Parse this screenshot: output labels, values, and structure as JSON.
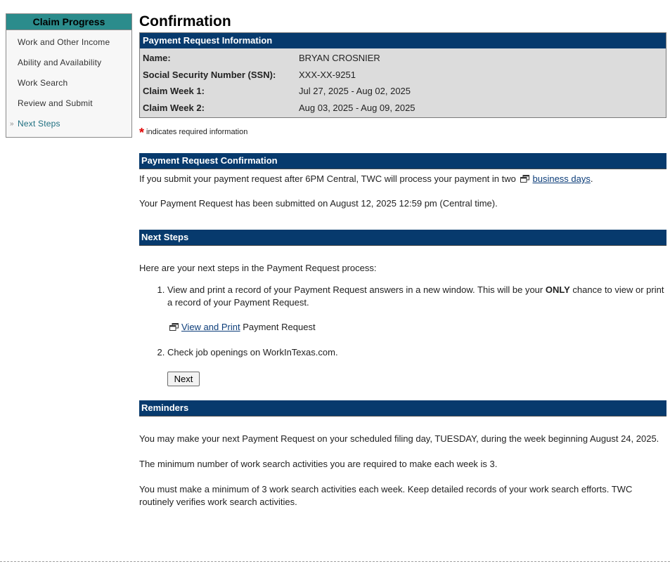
{
  "sidebar": {
    "title": "Claim Progress",
    "items": [
      {
        "label": "Work and Other Income"
      },
      {
        "label": "Ability and Availability"
      },
      {
        "label": "Work Search"
      },
      {
        "label": "Review and Submit"
      },
      {
        "label": "Next Steps",
        "active": true
      }
    ],
    "active_marker": "»"
  },
  "main": {
    "title": "Confirmation",
    "payment_info": {
      "header": "Payment Request Information",
      "rows": [
        {
          "label": "Name:",
          "value": "BRYAN CROSNIER"
        },
        {
          "label": "Social Security Number (SSN):",
          "value": "XXX-XX-9251"
        },
        {
          "label": "Claim Week 1:",
          "value": "Jul 27, 2025 - Aug 02, 2025"
        },
        {
          "label": "Claim Week 2:",
          "value": "Aug 03, 2025 - Aug 09, 2025"
        }
      ]
    },
    "required_note": {
      "star": "*",
      "text": "indicates required information"
    },
    "confirmation": {
      "header": "Payment Request Confirmation",
      "line1_prefix": "If you submit your payment request after 6PM Central, TWC will process your payment in two",
      "line1_link": "business days",
      "line1_suffix": ".",
      "line2": "Your Payment Request has been submitted on August 12, 2025 12:59 pm (Central time)."
    },
    "next_steps": {
      "header": "Next Steps",
      "intro": "Here are your next steps in the Payment Request process:",
      "step1_prefix": "View and print a record of your Payment Request answers in a new window. This will be your",
      "step1_bold": "ONLY",
      "step1_suffix": "chance to view or print a record of your Payment Request.",
      "view_print_link": "View and Print",
      "view_print_suffix": "Payment Request",
      "step2": "Check job openings on WorkInTexas.com.",
      "next_button": "Next"
    },
    "reminders": {
      "header": "Reminders",
      "line1": "You may make your next Payment Request on your scheduled filing day, TUESDAY, during the week beginning August 24, 2025.",
      "line2": "The minimum number of work search activities you are required to make each week is 3.",
      "line3": "You must make a minimum of 3 work search activities each week. Keep detailed records of your work search efforts. TWC routinely verifies work search activities."
    }
  },
  "icons": {
    "new_window": "new-window-icon",
    "chevron": "double-chevron-right-icon"
  },
  "colors": {
    "section_bar": "#073a6d",
    "sidebar_header": "#2b8c8c",
    "info_bg": "#dcdcdc",
    "link": "#0d3e7a",
    "required_star": "#e00000",
    "active_nav": "#1e6f80"
  }
}
